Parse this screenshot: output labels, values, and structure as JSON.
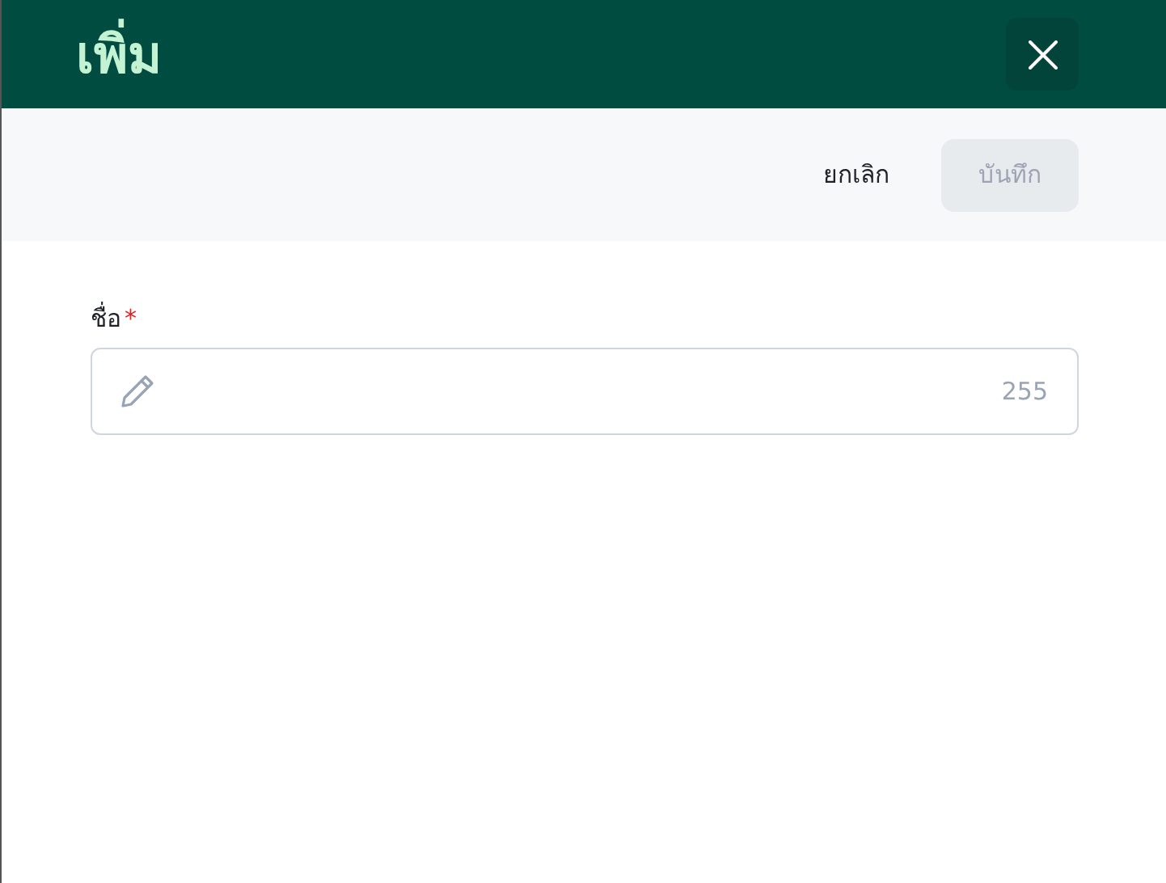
{
  "header": {
    "title": "เพิ่ม"
  },
  "toolbar": {
    "cancel": {
      "label": "ยกเลิก"
    },
    "save": {
      "label": "บันทึก",
      "disabled": true
    }
  },
  "field": {
    "label": "ชื่อ",
    "required": true,
    "required_mark": "*",
    "counter": "255"
  }
}
